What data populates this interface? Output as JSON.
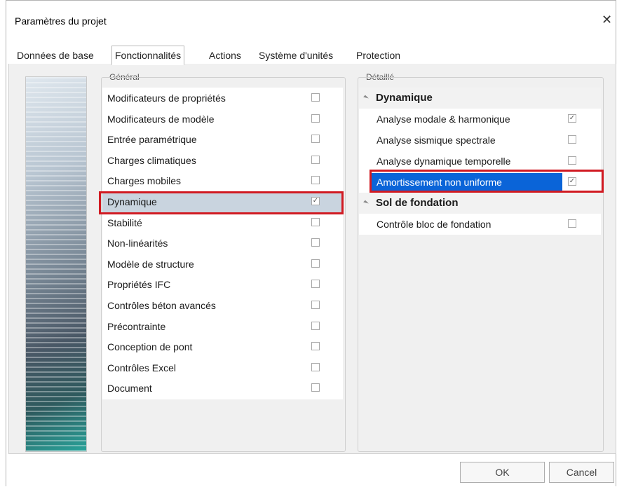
{
  "window": {
    "title": "Paramètres du projet"
  },
  "tabs": [
    {
      "label": "Données de base"
    },
    {
      "label": "Fonctionnalités"
    },
    {
      "label": "Actions"
    },
    {
      "label": "Système d'unités"
    },
    {
      "label": "Protection"
    }
  ],
  "general": {
    "label": "Général",
    "items": [
      {
        "label": "Modificateurs de propriétés",
        "checked": false
      },
      {
        "label": "Modificateurs de modèle",
        "checked": false
      },
      {
        "label": "Entrée paramétrique",
        "checked": false
      },
      {
        "label": "Charges climatiques",
        "checked": false
      },
      {
        "label": "Charges mobiles",
        "checked": false
      },
      {
        "label": "Dynamique",
        "checked": true,
        "selected": true
      },
      {
        "label": "Stabilité",
        "checked": false
      },
      {
        "label": "Non-linéarités",
        "checked": false
      },
      {
        "label": "Modèle de structure",
        "checked": false
      },
      {
        "label": "Propriétés IFC",
        "checked": false
      },
      {
        "label": "Contrôles béton avancés",
        "checked": false
      },
      {
        "label": "Précontrainte",
        "checked": false
      },
      {
        "label": "Conception de pont",
        "checked": false
      },
      {
        "label": "Contrôles Excel",
        "checked": false
      },
      {
        "label": "Document",
        "checked": false
      }
    ]
  },
  "detailed": {
    "label": "Détaillé",
    "categories": [
      {
        "label": "Dynamique",
        "items": [
          {
            "label": "Analyse modale & harmonique",
            "checked": true
          },
          {
            "label": "Analyse sismique spectrale",
            "checked": false
          },
          {
            "label": "Analyse dynamique temporelle",
            "checked": false
          },
          {
            "label": "Amortissement non uniforme",
            "checked": true,
            "selected": true
          }
        ]
      },
      {
        "label": "Sol de fondation",
        "items": [
          {
            "label": "Contrôle bloc de fondation",
            "checked": false
          }
        ]
      }
    ]
  },
  "buttons": {
    "ok": "OK",
    "cancel": "Cancel"
  },
  "icons": {
    "close": "close-icon",
    "check": "✓"
  },
  "colors": {
    "highlight_red": "#d11a22",
    "selection_blue": "#0a64d8",
    "selection_gray": "#c9d4df"
  }
}
